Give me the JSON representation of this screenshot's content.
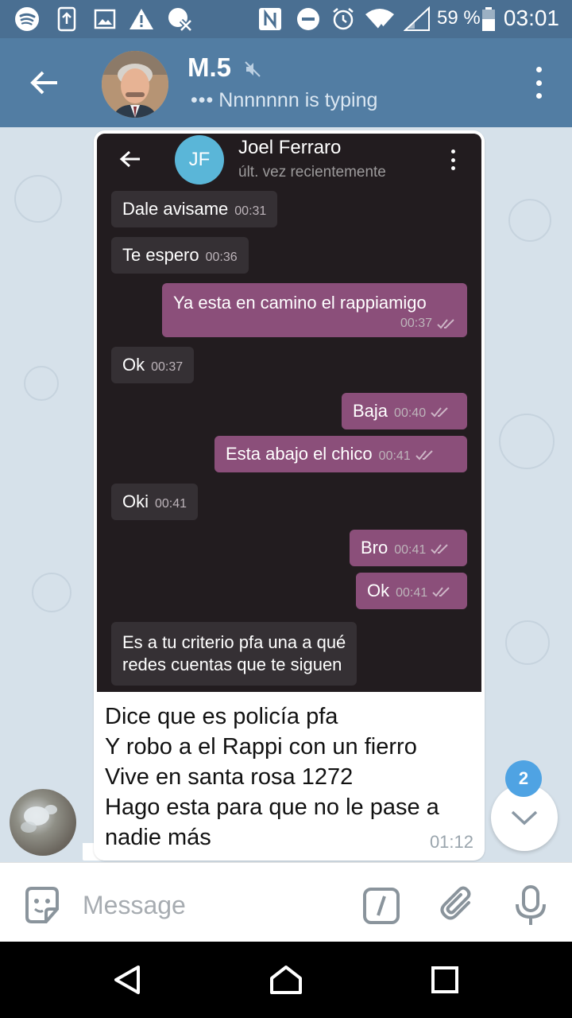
{
  "status_bar": {
    "battery": "59 %",
    "time": "03:01"
  },
  "header": {
    "title": "M.5",
    "typing_status": "Nnnnnnn is typing"
  },
  "screenshot": {
    "contact_initials": "JF",
    "contact_name": "Joel Ferraro",
    "contact_status": "últ. vez recientemente",
    "messages": [
      {
        "dir": "in",
        "text": "Dale avisame",
        "time": "00:31"
      },
      {
        "dir": "in",
        "text": "Te espero",
        "time": "00:36"
      },
      {
        "dir": "out",
        "text": "Ya esta en camino el rappiamigo",
        "time": "00:37"
      },
      {
        "dir": "in",
        "text": "Ok",
        "time": "00:37"
      },
      {
        "dir": "out",
        "text": "Baja",
        "time": "00:40"
      },
      {
        "dir": "out",
        "text": "Esta abajo el chico",
        "time": "00:41"
      },
      {
        "dir": "in",
        "text": "Oki",
        "time": "00:41"
      },
      {
        "dir": "out",
        "text": "Bro",
        "time": "00:41"
      },
      {
        "dir": "out",
        "text": "Ok",
        "time": "00:41"
      },
      {
        "dir": "in",
        "text": "Es a tu criterio pfa una a qué",
        "text2": "redes cuentas que te siguen",
        "time": ""
      }
    ]
  },
  "caption": {
    "lines": [
      "Dice que es policía pfa",
      "Y robo a el Rappi con un fierro",
      "Vive en santa rosa 1272",
      "Hago esta para que no le pase a",
      "nadie más"
    ],
    "time": "01:12"
  },
  "unread_count": "2",
  "composer": {
    "placeholder": "Message"
  },
  "colors": {
    "app_bar": "#527da3",
    "status_bar": "#4a6f92",
    "chat_bg": "#d6e1ea",
    "outgoing_bubble_in_shot": "#8b4f7a",
    "badge": "#4fa3e3"
  }
}
